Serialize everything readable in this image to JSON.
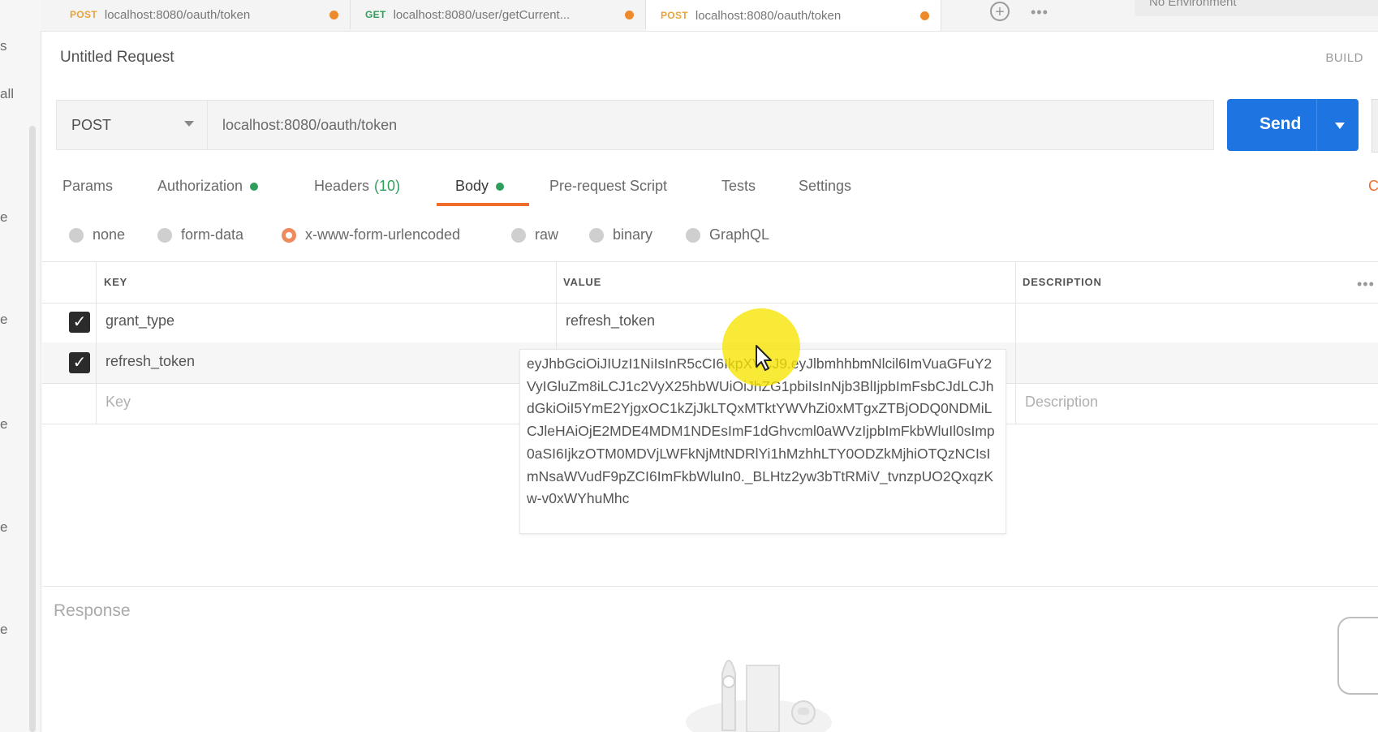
{
  "left_strip": {
    "fragments": [
      "s",
      "all",
      "e",
      "e",
      "e",
      "e",
      "e"
    ]
  },
  "tabs": [
    {
      "method": "POST",
      "url": "localhost:8080/oauth/token"
    },
    {
      "method": "GET",
      "url": "localhost:8080/user/getCurrent..."
    },
    {
      "method": "POST",
      "url": "localhost:8080/oauth/token"
    }
  ],
  "tab_actions": {
    "add": "+",
    "more": "•••"
  },
  "environment": {
    "label": "No Environment"
  },
  "request": {
    "title": "Untitled Request",
    "build_label": "BUILD",
    "method": "POST",
    "url": "localhost:8080/oauth/token",
    "send_label": "Send"
  },
  "request_tabs": [
    {
      "label": "Params"
    },
    {
      "label": "Authorization",
      "indicator": true
    },
    {
      "label": "Headers",
      "count": "(10)"
    },
    {
      "label": "Body",
      "indicator": true,
      "active": true
    },
    {
      "label": "Pre-request Script"
    },
    {
      "label": "Tests"
    },
    {
      "label": "Settings"
    }
  ],
  "cookies_fragment": "C",
  "body_types": [
    {
      "label": "none"
    },
    {
      "label": "form-data"
    },
    {
      "label": "x-www-form-urlencoded",
      "selected": true
    },
    {
      "label": "raw"
    },
    {
      "label": "binary"
    },
    {
      "label": "GraphQL"
    }
  ],
  "params_table": {
    "headers": {
      "key": "KEY",
      "value": "VALUE",
      "description": "DESCRIPTION"
    },
    "rows": [
      {
        "checked": true,
        "key": "grant_type",
        "value": "refresh_token"
      },
      {
        "checked": true,
        "key": "refresh_token",
        "value": "eyJhbGciOiJIUzI1NiIsInR5cCI6IkpXVCJ9.eyJlbmhhbmNlcil6ImVuaGFuY2VyIGluZm8iLCJ1c2VyX25hbWUiOiJhZG1pbiIsInNjb3BlIjpbImFsbCJdLCJhdGkiOiI5YmE2YjgxOC1kZjJkLTQxMTktYWVhZi0xMTgxZTBjODQ0NDMiLCJleHAiOjE2MDE4MDM1NDEsImF1dGhvcml0aWVzIjpbImFkbWluIl0sImp0aSI6IjkzOTM0MDVjLWFkNjMtNDRlYi1hMzhhLTY0ODZkMjhiOTQzNCIsImNsaWVudF9pZCI6ImFkbWluIn0._BLHtz2yw3bTtRMiV_tvnzpUO2QxqzKw-v0xWYhuMhc"
      }
    ],
    "new_row": {
      "key_placeholder": "Key",
      "description_placeholder": "Description"
    },
    "more": "•••"
  },
  "response": {
    "label": "Response"
  }
}
